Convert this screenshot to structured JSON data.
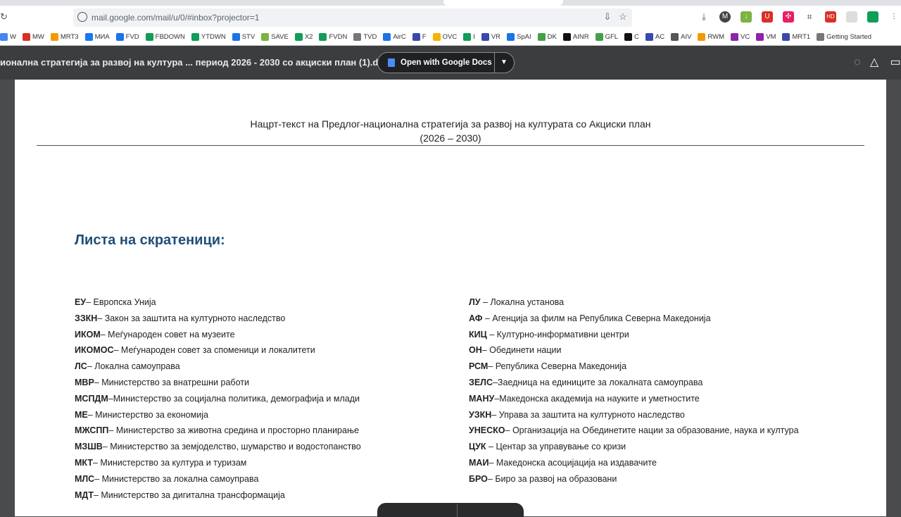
{
  "browser": {
    "url": "mail.google.com/mail/u/0/#inbox?projector=1",
    "bookmarks": [
      {
        "label": "W",
        "color": "#4285f4"
      },
      {
        "label": "MW",
        "color": "#d93025"
      },
      {
        "label": "MRT3",
        "color": "#f29900"
      },
      {
        "label": "МИА",
        "color": "#1877f2"
      },
      {
        "label": "FVD",
        "color": "#1a73e8"
      },
      {
        "label": "FBDOWN",
        "color": "#0f9d58"
      },
      {
        "label": "YTDWN",
        "color": "#0f9d58"
      },
      {
        "label": "STV",
        "color": "#1a73e8"
      },
      {
        "label": "SAVE",
        "color": "#7cb342"
      },
      {
        "label": "X2",
        "color": "#0f9d58"
      },
      {
        "label": "FVDN",
        "color": "#0f9d58"
      },
      {
        "label": "TVD",
        "color": "#777777"
      },
      {
        "label": "AirC",
        "color": "#1a73e8"
      },
      {
        "label": "F",
        "color": "#3949ab"
      },
      {
        "label": "OVC",
        "color": "#f4b400"
      },
      {
        "label": "I",
        "color": "#0f9d58"
      },
      {
        "label": "VR",
        "color": "#3949ab"
      },
      {
        "label": "SpAI",
        "color": "#1a73e8"
      },
      {
        "label": "DK",
        "color": "#43a047"
      },
      {
        "label": "AINR",
        "color": "#111111"
      },
      {
        "label": "GFL",
        "color": "#43a047"
      },
      {
        "label": "C",
        "color": "#111111"
      },
      {
        "label": "AC",
        "color": "#3949ab"
      },
      {
        "label": "AIV",
        "color": "#555555"
      },
      {
        "label": "RWM",
        "color": "#f29900"
      },
      {
        "label": "VC",
        "color": "#8e24aa"
      },
      {
        "label": "VM",
        "color": "#8e24aa"
      },
      {
        "label": "MRT1",
        "color": "#3949ab"
      },
      {
        "label": "Getting Started",
        "color": "#777777"
      }
    ]
  },
  "viewer": {
    "doc_title": "ионална стратегија за развој на култура ... период 2026 - 2030 со акциски план (1).doc",
    "open_button": "Open with Google Docs"
  },
  "document": {
    "header_line1": "Нацрт-текст на Предлог-национална стратегија за развој на културата со Акциски план",
    "header_line2": "(2026 – 2030)",
    "list_title": "Листа на скратеници:",
    "left_column": [
      {
        "abbr": "ЕУ",
        "desc": "– Европска Унија"
      },
      {
        "abbr": "ЗЗКН",
        "desc": "– Закон за заштита на културното наследство"
      },
      {
        "abbr": "ИКОМ",
        "desc": "– Меѓународен совет на музеите"
      },
      {
        "abbr": "ИКОМОС",
        "desc": "– Меѓународен совет за споменици и локалитети"
      },
      {
        "abbr": "ЛС",
        "desc": "– Локална самоуправа"
      },
      {
        "abbr": "МВР",
        "desc": "– Министерство за внатрешни работи"
      },
      {
        "abbr": "МСПДМ",
        "desc": "–Министерство за социјална политика, демографија и млади"
      },
      {
        "abbr": "МЕ",
        "desc": "– Министерство за економија"
      },
      {
        "abbr": "МЖСПП",
        "desc": "– Министерство за животна средина и просторно планирање"
      },
      {
        "abbr": "МЗШВ",
        "desc": "– Министерство за земјоделство, шумарство и водостопанство"
      },
      {
        "abbr": "МКТ",
        "desc": "– Министерство за култура и туризам"
      },
      {
        "abbr": "МЛС",
        "desc": "– Министерство за локална самоуправа"
      },
      {
        "abbr": "МДТ",
        "desc": "– Министерство за дигитална трансформација"
      }
    ],
    "right_column": [
      {
        "abbr": "ЛУ",
        "desc": " – Локална установа"
      },
      {
        "abbr": "АФ",
        "desc": " – Агенција за филм на Република Северна Македонија"
      },
      {
        "abbr": "КИЦ",
        "desc": " – Културно-информативни центри"
      },
      {
        "abbr": "ОН",
        "desc": "– Обединети нации"
      },
      {
        "abbr": "РСМ",
        "desc": "– Република Северна Македонија"
      },
      {
        "abbr": "ЗЕЛС",
        "desc": "–Заедница на единиците за локалната самоуправа"
      },
      {
        "abbr": "МАНУ",
        "desc": "–Македонска академија на науките и уметностите"
      },
      {
        "abbr": "УЗКН",
        "desc": "– Управа за заштита на културното наследство"
      },
      {
        "abbr": "УНЕСКО",
        "desc": "– Организација на Обединетите нации за образование, наука и култура"
      },
      {
        "abbr": "ЦУК",
        "desc": " – Центар за управување со кризи"
      },
      {
        "abbr": "МАИ",
        "desc": "– Македонска асоцијација на издавачите"
      },
      {
        "abbr": "БРО",
        "desc": "– Биро за развој на образовани"
      }
    ]
  },
  "colors": {
    "title_blue": "#1f4e79",
    "viewer_bg": "#3c3d3f",
    "gdocs_blue": "#4b8df8"
  }
}
